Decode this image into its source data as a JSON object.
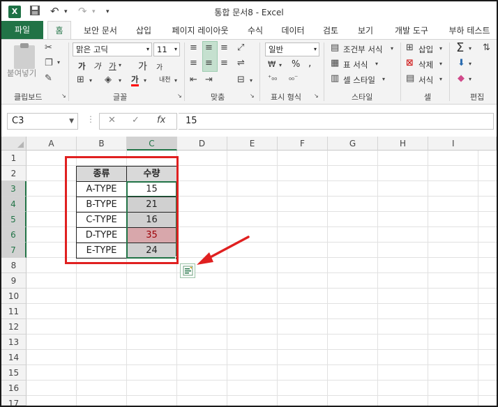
{
  "window": {
    "title": "통합 문서8 - Excel",
    "app_icon": "X"
  },
  "quick_access": {
    "save_icon": "save-icon",
    "undo_icon": "undo-icon",
    "redo_icon": "redo-icon"
  },
  "tabs": [
    "파일",
    "홈",
    "보안 문서",
    "삽입",
    "페이지 레이아웃",
    "수식",
    "데이터",
    "검토",
    "보기",
    "개발 도구",
    "부하 테스트"
  ],
  "ribbon": {
    "clipboard": {
      "paste": "붙여넣기",
      "label": "클립보드"
    },
    "font": {
      "name": "맑은 고딕",
      "size": "11",
      "bold": "가",
      "italic": "가",
      "underline": "가",
      "grow": "가",
      "shrink": "가",
      "phonetic": "내천",
      "label": "글꼴",
      "font_color": "#ff0000"
    },
    "alignment": {
      "label": "맞춤"
    },
    "number": {
      "format": "일반",
      "currency": "₩",
      "percent": "%",
      "comma": ",",
      "label": "표시 형식"
    },
    "styles": {
      "conditional": "조건부 서식",
      "table": "표 서식",
      "cell_styles": "셀 스타일",
      "label": "스타일"
    },
    "cells": {
      "insert": "삽입",
      "delete": "삭제",
      "format": "서식",
      "label": "셀"
    },
    "editing": {
      "sum": "Σ",
      "label": "편집"
    }
  },
  "formula_bar": {
    "name_box": "C3",
    "cancel": "✕",
    "enter": "✓",
    "fx": "fx",
    "value": "15"
  },
  "sheet": {
    "columns": [
      "A",
      "B",
      "C",
      "D",
      "E",
      "F",
      "G",
      "H",
      "I"
    ],
    "rows": [
      "1",
      "2",
      "3",
      "4",
      "5",
      "6",
      "7",
      "8",
      "9",
      "10",
      "11",
      "12",
      "13",
      "14",
      "15",
      "16",
      "17"
    ],
    "selected_column": "C",
    "selected_rows": [
      "3",
      "4",
      "5",
      "6",
      "7"
    ],
    "table": {
      "headers": [
        "종류",
        "수량"
      ],
      "rows": [
        [
          "A-TYPE",
          "15"
        ],
        [
          "B-TYPE",
          "21"
        ],
        [
          "C-TYPE",
          "16"
        ],
        [
          "D-TYPE",
          "35"
        ],
        [
          "E-TYPE",
          "24"
        ]
      ]
    }
  },
  "colors": {
    "excel_green": "#217346",
    "highlight_red": "#e02020",
    "gray_fill": "#d0d0d0",
    "pink_fill": "#d8a7ab",
    "pink_text": "#9c0006"
  }
}
